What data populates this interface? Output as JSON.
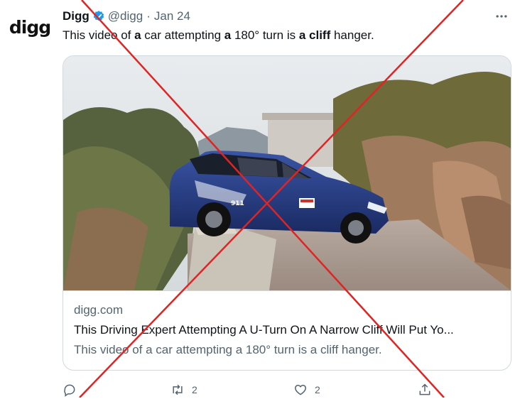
{
  "author": {
    "name": "Digg",
    "handle": "@digg",
    "separator": "·",
    "date": "Jan 24",
    "avatar_text": "digg"
  },
  "tweet": {
    "segments": [
      {
        "text": "This video of ",
        "bold": false
      },
      {
        "text": "a",
        "bold": true
      },
      {
        "text": " car attempting ",
        "bold": false
      },
      {
        "text": "a",
        "bold": true
      },
      {
        "text": " 180° turn is ",
        "bold": false
      },
      {
        "text": "a cliff",
        "bold": true
      },
      {
        "text": " hanger.",
        "bold": false
      }
    ]
  },
  "card": {
    "domain": "digg.com",
    "title": "This Driving Expert Attempting A U-Turn On A Narrow Cliff Will Put Yo...",
    "description": "This video of a car attempting a 180° turn is a cliff hanger.",
    "car_badge": "911"
  },
  "actions": {
    "reply_count": "",
    "retweet_count": "2",
    "like_count": "2"
  },
  "colors": {
    "verified": "#1d9bf0",
    "text_secondary": "#536471",
    "fact_check_cross": "#e02424",
    "car_body": "#1f2f6a"
  },
  "icons": [
    "verified-badge-icon",
    "more-icon",
    "reply-icon",
    "retweet-icon",
    "like-icon",
    "share-icon"
  ]
}
